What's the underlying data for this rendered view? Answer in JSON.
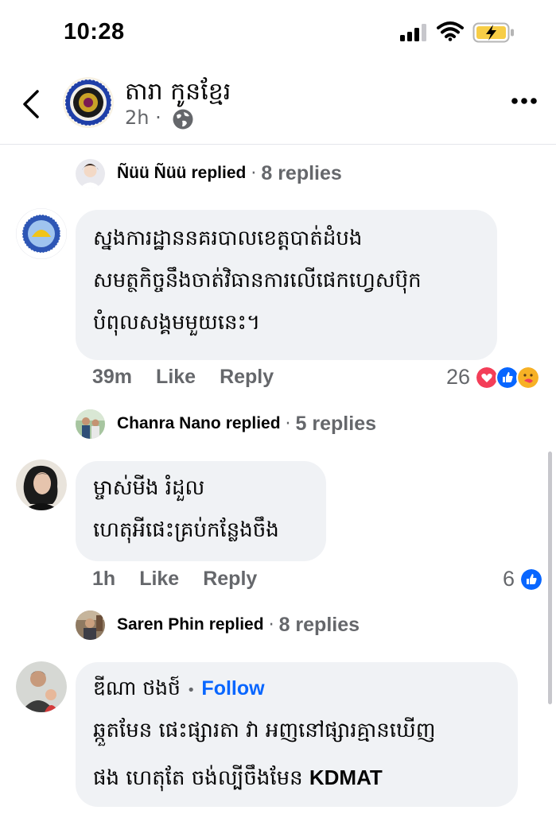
{
  "status": {
    "time": "10:28"
  },
  "header": {
    "page_name": "តារា កូនខ្មែរ",
    "time_ago": "2h",
    "dot": "·"
  },
  "threads": [
    {
      "author": "Ñüü Ñüü",
      "replied": "replied",
      "sep": "·",
      "count": "8 replies"
    },
    {
      "author": "Chanra Nano",
      "replied": "replied",
      "sep": "·",
      "count": "5 replies"
    },
    {
      "author": "Saren Phin",
      "replied": "replied",
      "sep": "·",
      "count": "8 replies"
    }
  ],
  "comments": [
    {
      "lines": [
        "ស្នងការដ្ឋាននគរបាលខេត្តបាត់ដំបង",
        "សមត្ថកិច្ចនឹងចាត់វិធានការលើផេកហ្វេសប៊ុក",
        "បំពុលសង្គមមួយនេះ។"
      ],
      "time": "39m",
      "like": "Like",
      "reply": "Reply",
      "reactions": "26"
    },
    {
      "lines": [
        "ម្ចាស់មីង រំដួល",
        "ហេតុអីផេះគ្រប់កន្លែងចឹង"
      ],
      "time": "1h",
      "like": "Like",
      "reply": "Reply",
      "reactions": "6"
    },
    {
      "author": "ឌីណា ថងថ៍",
      "follow_dot": "•",
      "follow": "Follow",
      "line1": "ឆ្កួតមែន  ផេះផ្សារតា វា អញនៅផ្សារគ្មានឃើញ",
      "line2_pre": "ផង ហេតុតែ ចង់ល្បីចឹងមែន ",
      "line2_bold": "KDMAT"
    }
  ],
  "icons": {
    "back": "chevron-left-icon",
    "globe": "globe-icon",
    "more": "more-horizontal-icon",
    "love": "heart-reaction-icon",
    "like": "like-reaction-icon",
    "care": "care-reaction-icon"
  },
  "colors": {
    "blue": "#0866ff",
    "bubble": "#f0f2f5",
    "grey_text": "#65676b",
    "love": "#f33e58"
  }
}
